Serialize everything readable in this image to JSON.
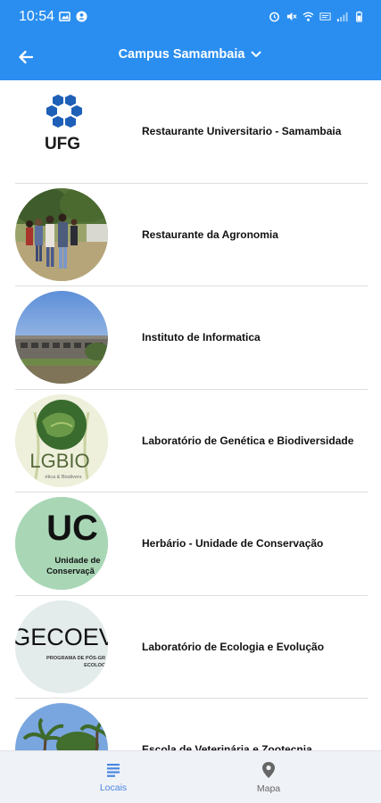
{
  "status_bar": {
    "time": "10:54",
    "icons_left": [
      "image-icon",
      "account-circle-icon"
    ],
    "icons_right": [
      "alarm-icon",
      "mute-icon",
      "wifi-icon",
      "volte-icon",
      "signal-icon",
      "battery-icon"
    ]
  },
  "app_bar": {
    "title": "Campus Samambaia",
    "back_icon": "arrow-left-icon",
    "dropdown_icon": "chevron-down-icon",
    "background": "#2a8ef0"
  },
  "locations": [
    {
      "label": "Restaurante Universitario - Samambaia",
      "image": "ufg-logo",
      "logo_text": "UFG"
    },
    {
      "label": "Restaurante da Agronomia",
      "image": "photo-people-outdoors"
    },
    {
      "label": "Instituto de Informatica",
      "image": "photo-building"
    },
    {
      "label": "Laboratório de Genética e Biodiversidade",
      "image": "lgbio-logo",
      "logo_text": "LGBIO",
      "logo_subtext": "ética & Biodivers"
    },
    {
      "label": "Herbário - Unidade de Conservação",
      "image": "uc-logo",
      "logo_text": "UC",
      "logo_subtext_1": "Unidade de",
      "logo_subtext_2": "Conservaçã"
    },
    {
      "label": "Laboratório de Ecologia e Evolução",
      "image": "gecoev-logo",
      "logo_text": "GECOEV",
      "logo_subtext_1": "PROGRAMA DE PÓS-GR",
      "logo_subtext_2": "ECOLOGI"
    },
    {
      "label": "Escola de Veterinária e Zootecnia",
      "image": "photo-palm-trees"
    }
  ],
  "bottom_nav": {
    "items": [
      {
        "label": "Locais",
        "icon": "list-icon",
        "active": true
      },
      {
        "label": "Mapa",
        "icon": "map-pin-icon",
        "active": false
      }
    ],
    "active_color": "#4a86e0"
  }
}
